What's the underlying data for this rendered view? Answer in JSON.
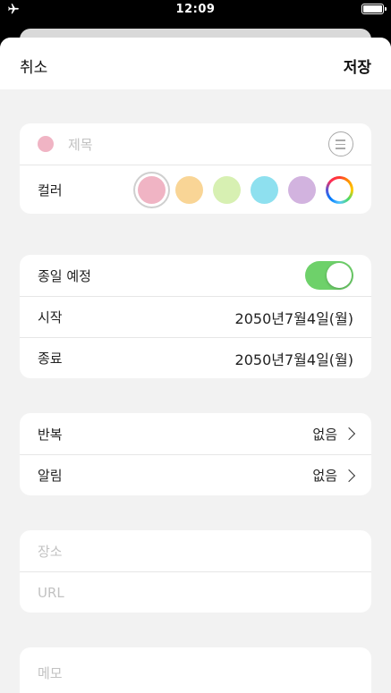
{
  "status_bar": {
    "time": "12:09"
  },
  "nav": {
    "cancel_label": "취소",
    "save_label": "저장"
  },
  "title_card": {
    "title_placeholder": "제목",
    "color_label": "컬러",
    "selected_dot_color": "#f0b4c4",
    "colors": [
      "#f0b4c4",
      "#f9d596",
      "#d7f0b2",
      "#8ee0ef",
      "#d2b3df"
    ]
  },
  "time_card": {
    "all_day_label": "종일 예정",
    "all_day_enabled": true,
    "start_label": "시작",
    "start_value": "2050년7월4일(월)",
    "end_label": "종료",
    "end_value": "2050년7월4일(월)"
  },
  "options_card": {
    "repeat_label": "반복",
    "repeat_value": "없음",
    "alert_label": "알림",
    "alert_value": "없음"
  },
  "location_card": {
    "place_placeholder": "장소",
    "url_placeholder": "URL"
  },
  "memo_card": {
    "memo_placeholder": "메모"
  }
}
